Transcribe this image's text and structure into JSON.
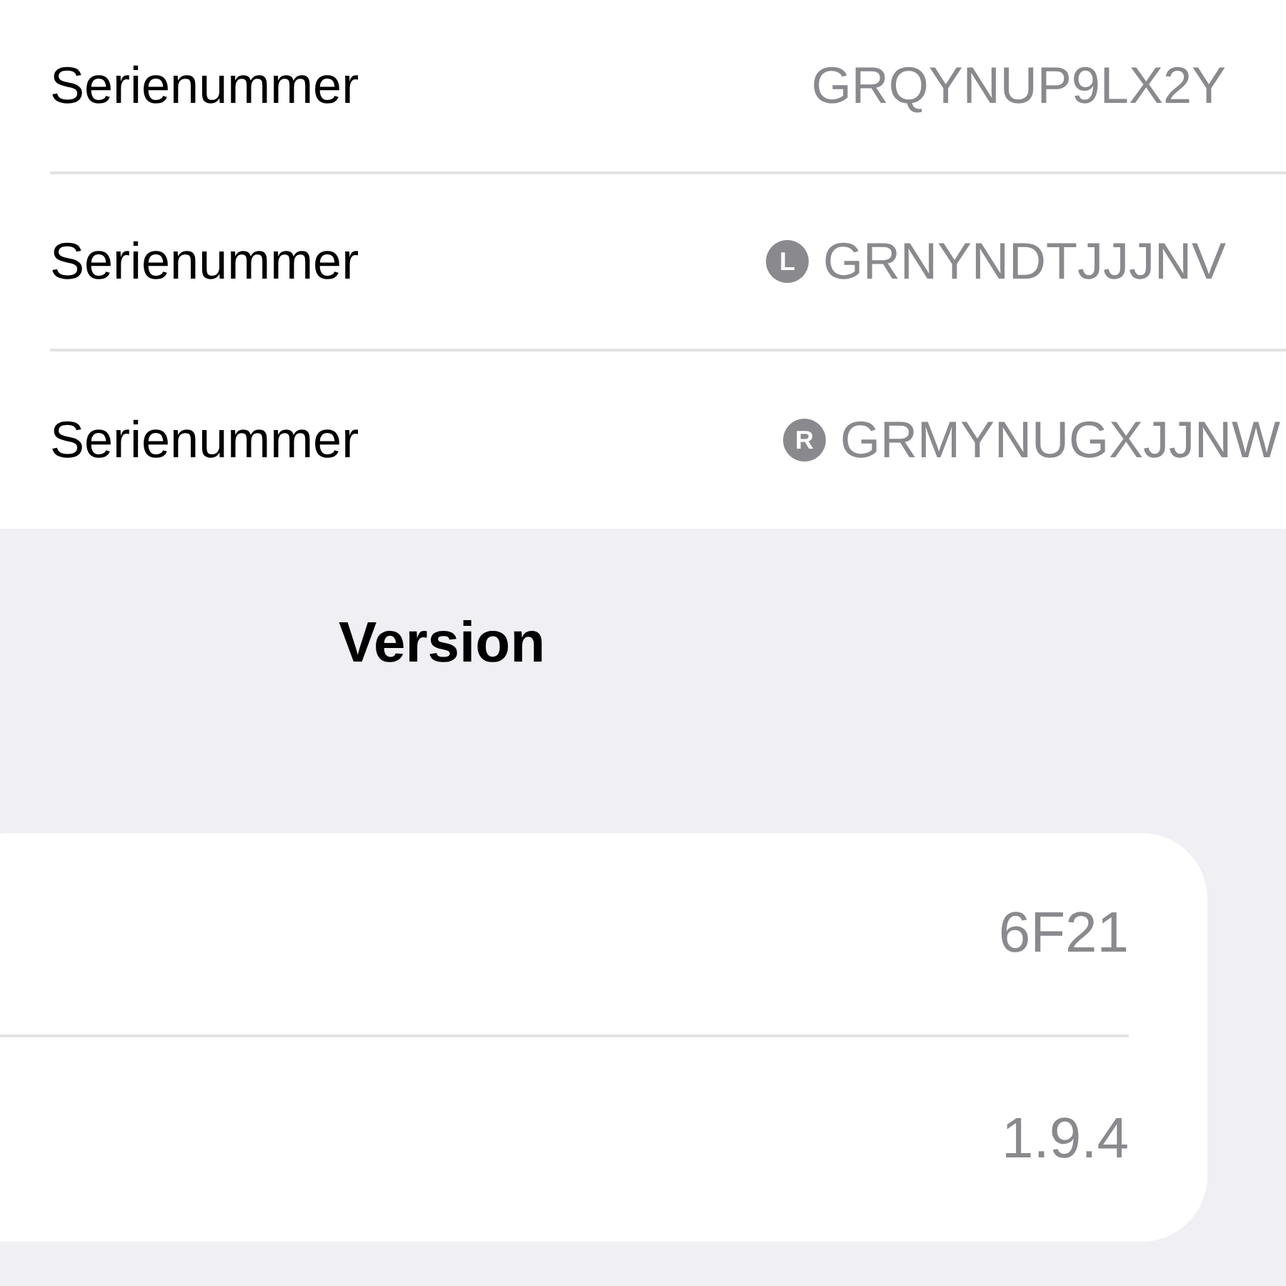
{
  "serial_rows": [
    {
      "label": "Serienummer",
      "value": "GRQYNUP9LX2Y"
    },
    {
      "label": "Serienummer",
      "badge": "L",
      "value": "GRNYNDTJJJNV"
    },
    {
      "label": "Serienummer",
      "badge": "R",
      "value": "GRMYNUGXJJNW"
    }
  ],
  "section_title": "Version",
  "version_rows": [
    {
      "value": "6F21"
    },
    {
      "value": "1.9.4"
    }
  ]
}
